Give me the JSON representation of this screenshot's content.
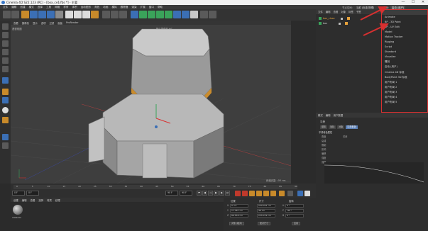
{
  "window": {
    "title": "Cinema 4D S22.123 (RC) - [box_ce1ifbs *] - 主要",
    "controls": [
      "—",
      "☐",
      "✕"
    ]
  },
  "menubar": [
    "文件",
    "编辑",
    "创建",
    "模式",
    "选择",
    "工具",
    "网格",
    "样条",
    "体积",
    "运动图形",
    "角色",
    "动画",
    "模拟",
    "跟踪器",
    "渲染",
    "扩展",
    "窗口",
    "帮助"
  ],
  "top_right": {
    "node_space": "节点空间:",
    "node_value": "当前 (标准/物理)",
    "layout_label": "界面:",
    "layout_value": "启动 (用户)"
  },
  "layout_dropdown": {
    "items": [
      "Animate",
      "BP - 3D Paint",
      "BP - UV Edit",
      "Model",
      "Motion Tracker",
      "Rigging",
      "Script",
      "Standard",
      "Visualize",
      "雕刻",
      "启动 (用户)",
      "Cinema 4D 标准",
      "BodyPaint 3D 标准",
      "用户布局 1",
      "用户布局 2",
      "用户布局 3",
      "用户布局 4",
      "用户布局 5"
    ],
    "highlight_color": "#d83030"
  },
  "viewport": {
    "menu": [
      "查看",
      "摄像机",
      "显示",
      "选项",
      "过滤",
      "面板",
      "ProRender"
    ],
    "view_name": "透视视图",
    "camera_label": "默认摄像机 ✿°",
    "grid_spacing": "网格间距 : 50 cm"
  },
  "object_manager": {
    "menu": [
      "文件",
      "编辑",
      "查看",
      "对象",
      "标签",
      "书签"
    ],
    "objects": [
      {
        "name": "box_close",
        "color": "#e6a23c"
      },
      {
        "name": "box",
        "color": "#e6a23c"
      }
    ]
  },
  "attributes": {
    "menu": [
      "模式",
      "编辑",
      "用户数据"
    ],
    "title": "平滑",
    "tabs": [
      "基本",
      "坐标",
      "对象",
      "平滑着色"
    ],
    "section": "平滑着色属性",
    "rows": [
      "角度",
      "关闭",
      "衰减",
      "限制",
      "影响",
      "偏移",
      "强度",
      "强度"
    ]
  },
  "timeline": {
    "ticks": [
      "0",
      "5",
      "10",
      "15",
      "20",
      "25",
      "30",
      "35",
      "40",
      "45",
      "50",
      "55",
      "60",
      "65",
      "70",
      "75",
      "80",
      "85",
      "90"
    ],
    "current_frame": "0 F",
    "start_frame": "0 F",
    "end_frame": "90 F",
    "end_frame2": "90 F"
  },
  "material_manager": {
    "menu": [
      "创建",
      "编辑",
      "查看",
      "选择",
      "材质",
      "纹理"
    ],
    "material_name": "material"
  },
  "coordinates": {
    "headers": [
      "位置",
      "尺寸",
      "旋转"
    ],
    "rows": [
      {
        "axis": "X",
        "pos": "0 cm",
        "size": "250.001 cm",
        "rot_label": "H",
        "rot": "0 °"
      },
      {
        "axis": "Y",
        "pos": "17.387 cm",
        "size": "46 cm",
        "rot_label": "P",
        "rot": "-90 °"
      },
      {
        "axis": "Z",
        "pos": "86.556 cm",
        "size": "235.079 cm",
        "rot_label": "B",
        "rot": "0 °"
      }
    ],
    "mode_left": "对象 (相对)",
    "mode_mid": "绝对尺寸",
    "apply": "应用"
  },
  "colors": {
    "accent_orange": "#e6a23c",
    "annotation_red": "#d83030",
    "viewport_bg": "#3e3e3e"
  }
}
